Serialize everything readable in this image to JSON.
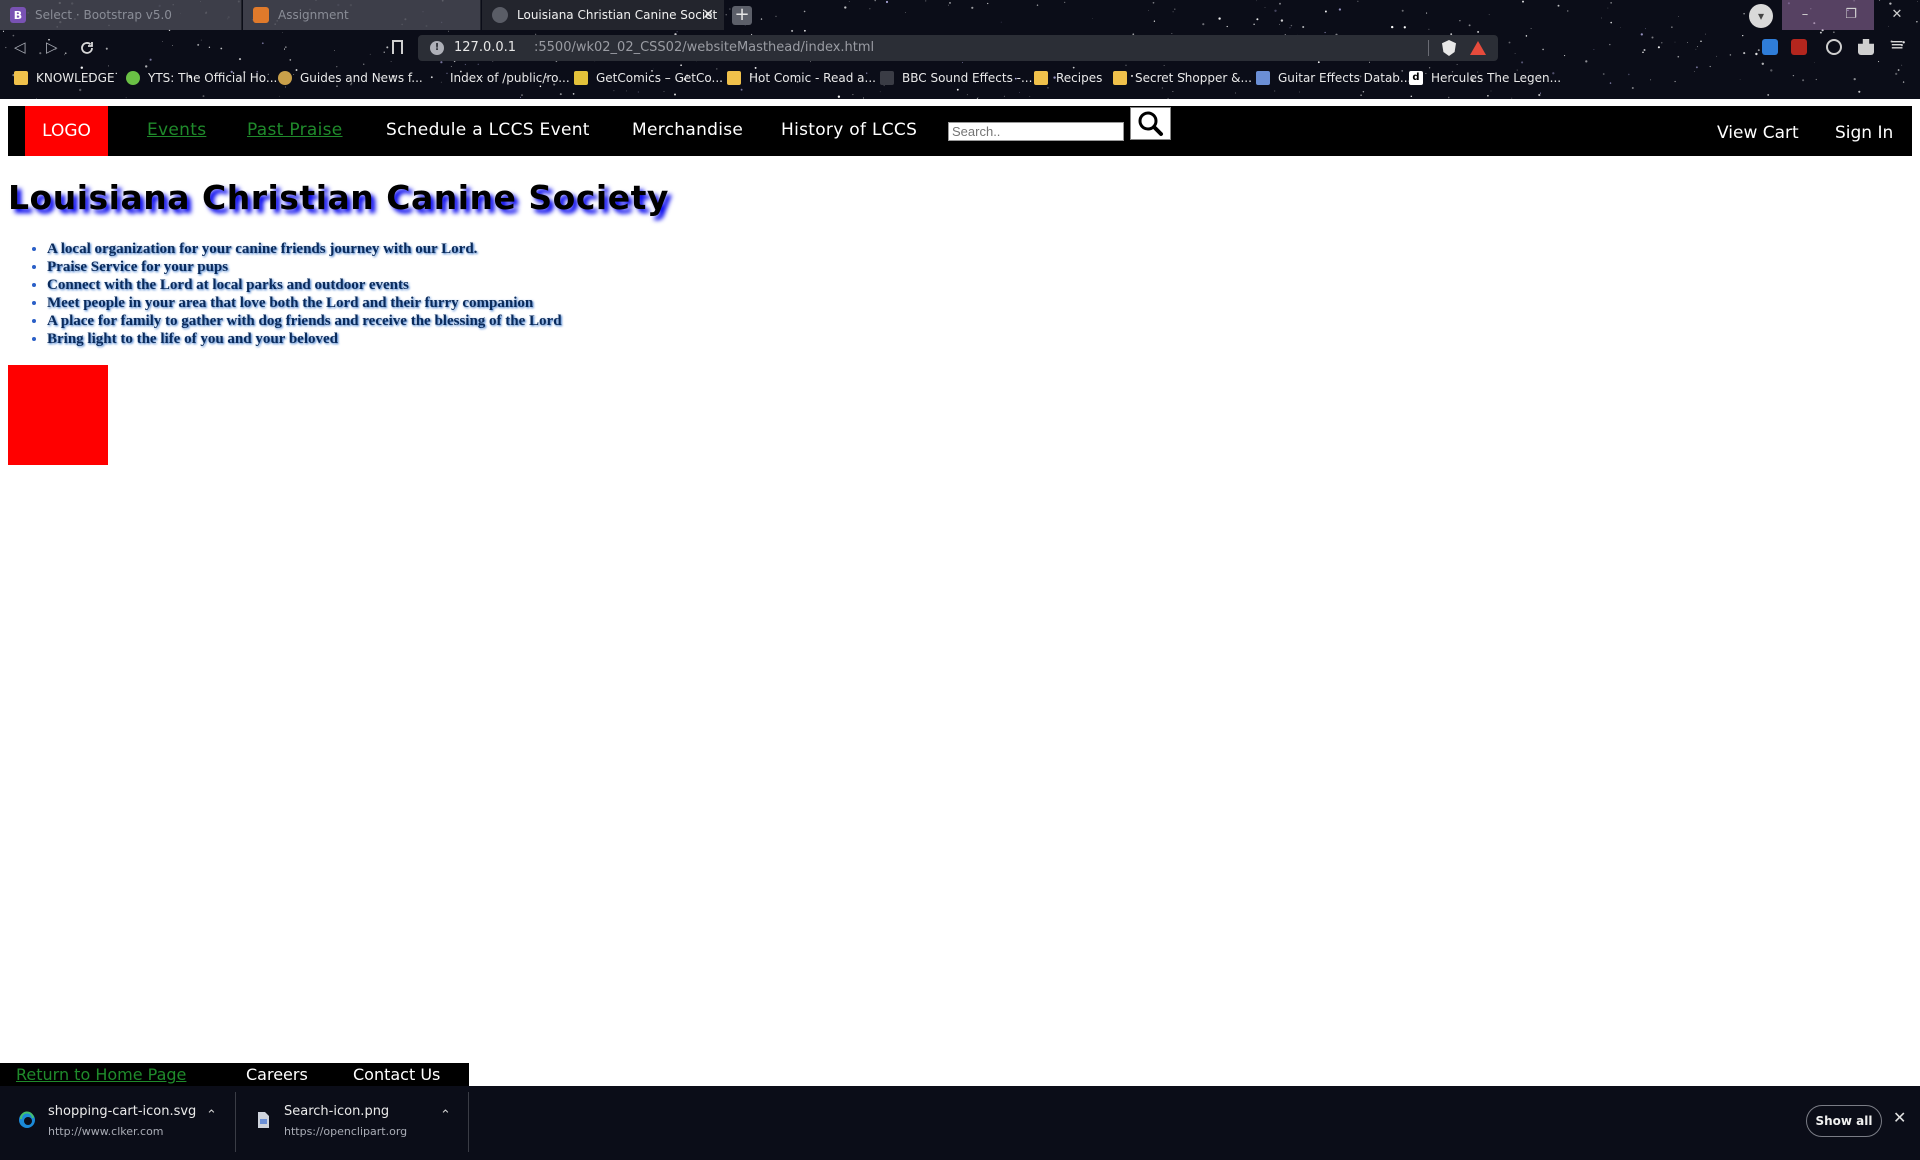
{
  "browser": {
    "tabs": [
      {
        "title": "Select · Bootstrap v5.0",
        "favicon": "B",
        "favicon_color": "#7952b3"
      },
      {
        "title": "Assignment",
        "favicon": "",
        "favicon_color": "#e07a2b"
      },
      {
        "title": "Louisiana Christian Canine Societ",
        "favicon": "",
        "favicon_color": "#5a5d66",
        "close": "✕"
      }
    ],
    "new_tab": "+",
    "window_controls": {
      "minimize": "–",
      "maximize": "❐",
      "close": "✕"
    },
    "address": {
      "host": "127.0.0.1",
      "path": ":5500/wk02_02_CSS02/websiteMasthead/index.html",
      "info": "!"
    },
    "bookmarks": [
      {
        "label": "KNOWLEDGE",
        "icon_color": "#f0c14b"
      },
      {
        "label": "YTS: The Official Ho...",
        "icon_color": "#6ac045"
      },
      {
        "label": "Guides and News f...",
        "icon_color": "#c9a04a"
      },
      {
        "label": "Index of /public/ro...",
        "icon_color": ""
      },
      {
        "label": "GetComics – GetCo...",
        "icon_color": "#e3c23a"
      },
      {
        "label": "Hot Comic - Read a...",
        "icon_color": "#f0c14b"
      },
      {
        "label": "BBC Sound Effects -...",
        "icon_color": "#e9e9e9"
      },
      {
        "label": "Recipes",
        "icon_color": "#f0c14b"
      },
      {
        "label": "Secret Shopper &...",
        "icon_color": "#f0c14b"
      },
      {
        "label": "Guitar Effects Datab...",
        "icon_color": "#6b8fd6"
      },
      {
        "label": "Hercules The Legen...",
        "icon_color": "#ffffff"
      }
    ]
  },
  "navbar": {
    "logo": "LOGO",
    "links": [
      "Events",
      "Past Praise",
      "Schedule a LCCS Event",
      "Merchandise",
      "History of LCCS"
    ],
    "search_placeholder": "Search..",
    "view_cart": "View Cart",
    "sign_in": "Sign In",
    "logo_color": "#ff0000",
    "link_visited_color": "#1f8a2b"
  },
  "main": {
    "title": "Louisiana Christian Canine Society",
    "features": [
      "A local organization for your canine friends journey with our Lord.",
      "Praise Service for your pups",
      "Connect with the Lord at local parks and outdoor events",
      "Meet people in your area that love both the Lord and their furry companion",
      "A place for family to gather with dog friends and receive the blessing of the Lord",
      "Bring light to the life of you and your beloved"
    ]
  },
  "footer": {
    "links": [
      "Return to Home Page",
      "Careers",
      "Contact Us"
    ]
  },
  "downloads": {
    "items": [
      {
        "name": "shopping-cart-icon.svg",
        "source": "http://www.clker.com",
        "icon": "edge-icon"
      },
      {
        "name": "Search-icon.png",
        "source": "https://openclipart.org",
        "icon": "file-icon"
      }
    ],
    "show_all": "Show all",
    "close": "✕"
  }
}
